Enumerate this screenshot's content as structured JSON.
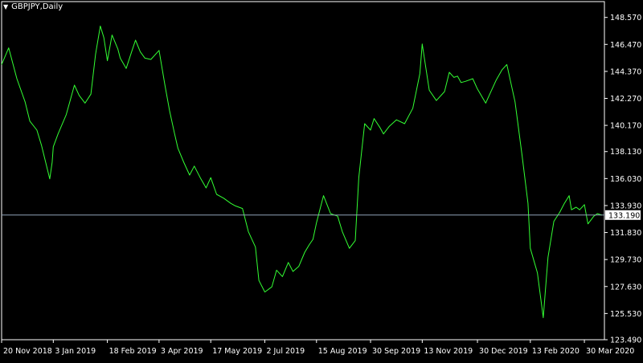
{
  "window": {
    "title": "GBPJPY,Daily",
    "menu_icon": "triangle-down-icon"
  },
  "colors": {
    "background": "#000000",
    "frame": "#ffffff",
    "price_line": "#33ff33",
    "current_price_line": "#8fa3b8",
    "text": "#ffffff",
    "price_label_bg": "#ffffff",
    "price_label_text": "#000000"
  },
  "chart_data": {
    "type": "line",
    "symbol": "GBPJPY",
    "timeframe": "Daily",
    "title": "GBPJPY,Daily",
    "xlabel": "",
    "ylabel": "",
    "grid": false,
    "legend": "none",
    "xlim": [
      "2018-11-20",
      "2020-04-14"
    ],
    "ylim": [
      123.49,
      149.8
    ],
    "y_ticks": [
      "148.570",
      "146.470",
      "144.370",
      "142.270",
      "140.170",
      "138.130",
      "136.030",
      "133.930",
      "131.830",
      "129.730",
      "127.630",
      "125.530",
      "123.490"
    ],
    "x_ticks": [
      "20 Nov 2018",
      "3 Jan 2019",
      "18 Feb 2019",
      "3 Apr 2019",
      "17 May 2019",
      "2 Jul 2019",
      "15 Aug 2019",
      "30 Sep 2019",
      "13 Nov 2019",
      "30 Dec 2019",
      "13 Feb 2020",
      "30 Mar 2020"
    ],
    "x_tick_dates": [
      "2018-11-20",
      "2019-01-03",
      "2019-02-18",
      "2019-04-03",
      "2019-05-17",
      "2019-07-02",
      "2019-08-15",
      "2019-09-30",
      "2019-11-13",
      "2019-12-30",
      "2020-02-13",
      "2020-03-30"
    ],
    "current_price": "133.190",
    "current_price_value": 133.19,
    "series": [
      {
        "x": [
          "2018-11-20",
          "2018-11-26",
          "2018-12-03",
          "2018-12-10",
          "2018-12-14",
          "2018-12-20",
          "2018-12-24",
          "2018-12-31",
          "2019-01-02",
          "2019-01-03",
          "2019-01-07",
          "2019-01-14",
          "2019-01-21",
          "2019-01-25",
          "2019-01-30",
          "2019-02-04",
          "2019-02-08",
          "2019-02-12",
          "2019-02-15",
          "2019-02-18",
          "2019-02-22",
          "2019-02-27",
          "2019-03-01",
          "2019-03-06",
          "2019-03-11",
          "2019-03-14",
          "2019-03-18",
          "2019-03-22",
          "2019-03-27",
          "2019-04-03",
          "2019-04-08",
          "2019-04-12",
          "2019-04-16",
          "2019-04-19",
          "2019-04-24",
          "2019-04-29",
          "2019-05-03",
          "2019-05-08",
          "2019-05-13",
          "2019-05-17",
          "2019-05-22",
          "2019-05-28",
          "2019-06-03",
          "2019-06-07",
          "2019-06-13",
          "2019-06-18",
          "2019-06-24",
          "2019-06-27",
          "2019-07-02",
          "2019-07-08",
          "2019-07-12",
          "2019-07-17",
          "2019-07-22",
          "2019-07-26",
          "2019-07-31",
          "2019-08-05",
          "2019-08-09",
          "2019-08-12",
          "2019-08-15",
          "2019-08-21",
          "2019-08-27",
          "2019-09-02",
          "2019-09-06",
          "2019-09-12",
          "2019-09-17",
          "2019-09-20",
          "2019-09-25",
          "2019-09-30",
          "2019-10-03",
          "2019-10-08",
          "2019-10-11",
          "2019-10-16",
          "2019-10-22",
          "2019-10-29",
          "2019-11-05",
          "2019-11-11",
          "2019-11-13",
          "2019-11-19",
          "2019-11-25",
          "2019-12-02",
          "2019-12-06",
          "2019-12-10",
          "2019-12-13",
          "2019-12-16",
          "2019-12-20",
          "2019-12-26",
          "2019-12-30",
          "2020-01-06",
          "2020-01-10",
          "2020-01-15",
          "2020-01-20",
          "2020-01-24",
          "2020-01-31",
          "2020-02-06",
          "2020-02-11",
          "2020-02-13",
          "2020-02-19",
          "2020-02-24",
          "2020-02-28",
          "2020-03-04",
          "2020-03-09",
          "2020-03-13",
          "2020-03-17",
          "2020-03-19",
          "2020-03-23",
          "2020-03-26",
          "2020-03-30",
          "2020-04-02",
          "2020-04-07",
          "2020-04-10",
          "2020-04-14"
        ],
        "y": [
          144.9,
          146.2,
          143.8,
          142.0,
          140.5,
          139.8,
          138.6,
          136.0,
          137.3,
          138.5,
          139.5,
          141.0,
          143.3,
          142.5,
          141.9,
          142.6,
          145.7,
          147.9,
          147.0,
          145.2,
          147.2,
          146.1,
          145.4,
          144.6,
          146.0,
          146.8,
          145.9,
          145.4,
          145.3,
          146.0,
          143.3,
          141.3,
          139.6,
          138.4,
          137.3,
          136.3,
          137.0,
          136.1,
          135.3,
          136.1,
          134.8,
          134.5,
          134.1,
          133.9,
          133.7,
          131.9,
          130.7,
          128.1,
          127.2,
          127.6,
          128.9,
          128.4,
          129.5,
          128.8,
          129.2,
          130.3,
          130.9,
          131.3,
          132.6,
          134.7,
          133.3,
          133.1,
          131.9,
          130.6,
          131.2,
          136.1,
          140.3,
          139.8,
          140.7,
          140.0,
          139.5,
          140.1,
          140.6,
          140.3,
          141.5,
          144.2,
          146.5,
          142.9,
          142.1,
          142.8,
          144.3,
          143.9,
          144.0,
          143.5,
          143.6,
          143.8,
          143.0,
          141.9,
          142.7,
          143.7,
          144.5,
          144.9,
          142.0,
          137.8,
          134.1,
          130.6,
          128.7,
          125.2,
          129.9,
          132.7,
          133.4,
          134.1,
          134.7,
          133.6,
          133.8,
          133.6,
          134.0,
          132.5,
          133.1,
          133.3,
          133.19
        ]
      }
    ]
  }
}
